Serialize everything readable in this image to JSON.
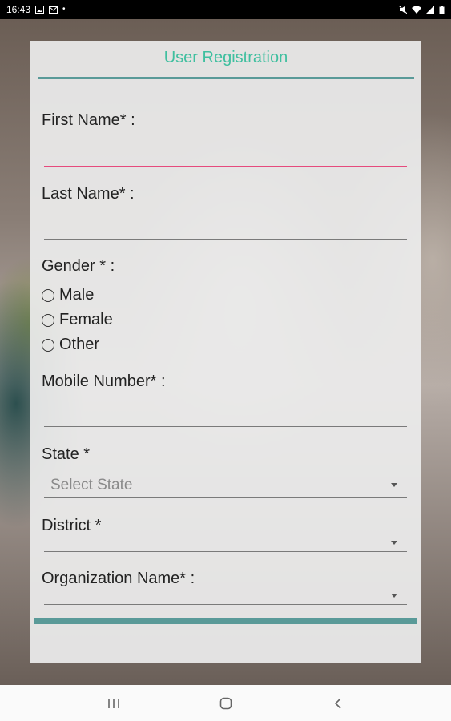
{
  "status_bar": {
    "time": "16:43",
    "left_icons": [
      "image-icon",
      "mail-icon",
      "dots-icon"
    ],
    "right_icons": [
      "mute-icon",
      "wifi-icon",
      "signal-icon",
      "battery-icon"
    ]
  },
  "form": {
    "title": "User Registration",
    "first_name": {
      "label": "First Name* :",
      "value": ""
    },
    "last_name": {
      "label": "Last Name* :",
      "value": ""
    },
    "gender": {
      "label": "Gender * :",
      "options": [
        "Male",
        "Female",
        "Other"
      ]
    },
    "mobile": {
      "label": "Mobile Number* :",
      "value": ""
    },
    "state": {
      "label": "State *",
      "placeholder": "Select State"
    },
    "district": {
      "label": "District *",
      "value": ""
    },
    "organization": {
      "label": "Organization Name* :",
      "value": ""
    }
  },
  "colors": {
    "title": "#3fbf9f",
    "accent_rule": "#5a9a98",
    "active_underline": "#e64a7d"
  },
  "navigation": [
    "recent-apps-button",
    "home-button",
    "back-button"
  ]
}
